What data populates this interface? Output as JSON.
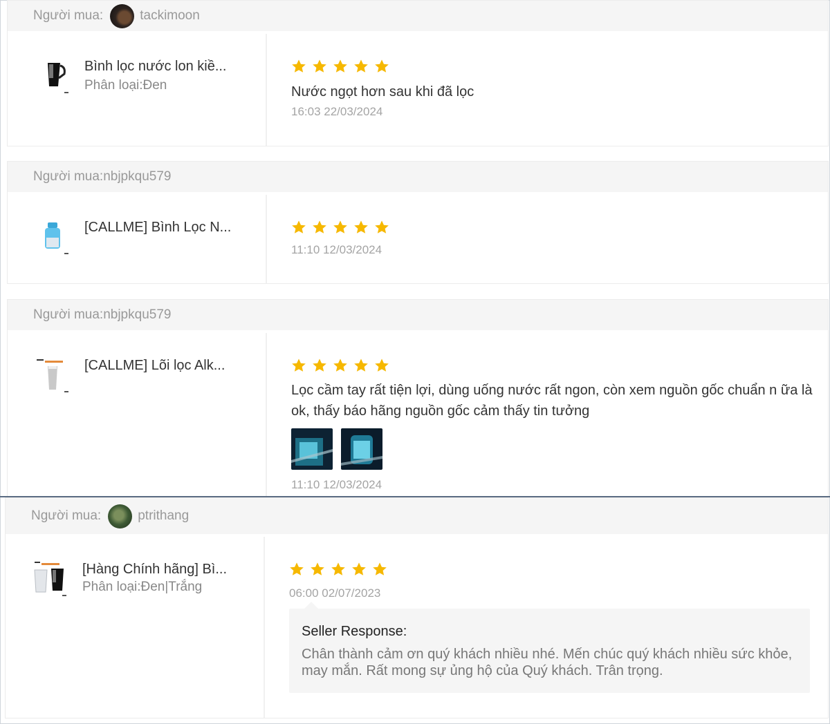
{
  "reviews": [
    {
      "buyer_label": "Người mua:",
      "buyer_name": "tackimoon",
      "product_name": "Bình lọc nước lon kiề...",
      "product_variant": "Phân loại:Đen",
      "rating": 5,
      "comment": "Nước ngọt hơn sau khi đã lọc",
      "date": "16:03 22/03/2024"
    },
    {
      "buyer_label": "Người mua:nbjpkqu579",
      "buyer_name": "",
      "product_name": "[CALLME] Bình Lọc N...",
      "product_variant": "",
      "rating": 5,
      "comment": "",
      "date": "11:10 12/03/2024"
    },
    {
      "buyer_label": "Người mua:nbjpkqu579",
      "buyer_name": "",
      "product_name": "[CALLME] Lõi lọc Alk...",
      "product_variant": "",
      "rating": 5,
      "comment": "Lọc cầm tay rất tiện lợi, dùng uống nước rất ngon, còn xem nguồn gốc chuẩn n ữa là ok, thấy báo hãng nguồn gốc cảm thấy tin tưởng",
      "date": "11:10 12/03/2024"
    },
    {
      "buyer_label": "Người mua:",
      "buyer_name": "ptrithang",
      "product_name": "[Hàng Chính hãng] Bì...",
      "product_variant": "Phân loại:Đen|Trắng",
      "rating": 5,
      "comment": "",
      "date": "06:00 02/07/2023",
      "seller_response_title": "Seller Response:",
      "seller_response_text": "Chân thành cảm ơn quý khách nhiều nhé. Mến chúc quý khách nhiều sức khỏe, may mắn. Rất mong sự ủng hộ của Quý khách. Trân trọng."
    }
  ],
  "icons": {
    "star": "star-icon"
  },
  "colors": {
    "star": "#f6b800",
    "divider": "#5a6b82"
  }
}
